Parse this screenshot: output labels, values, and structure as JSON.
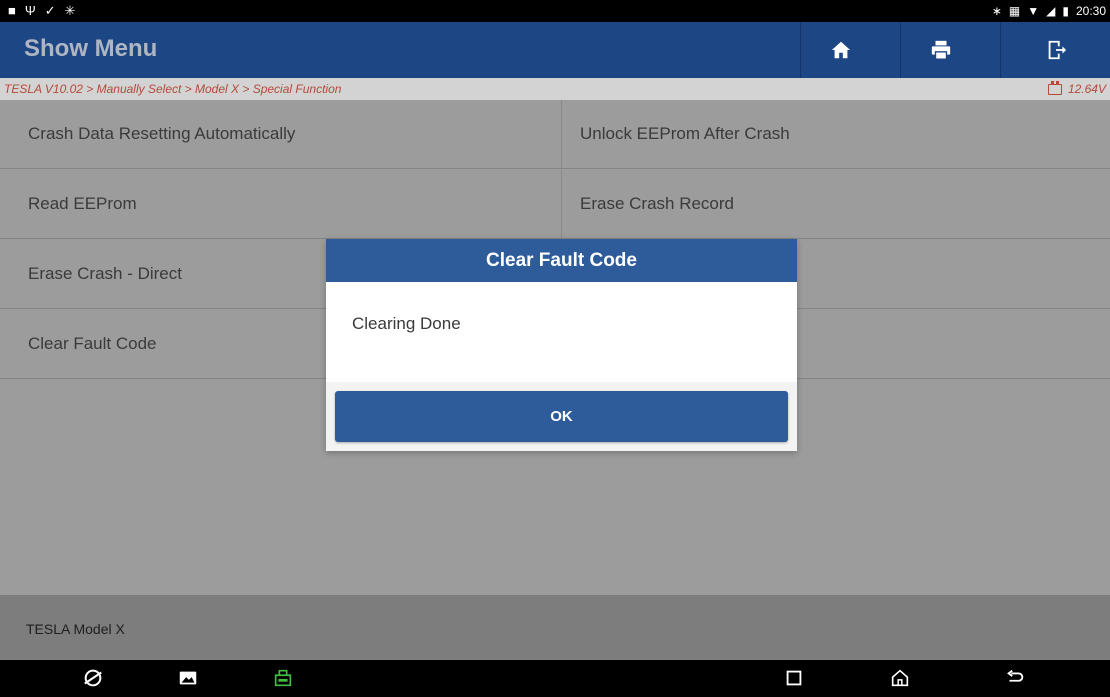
{
  "status_bar": {
    "left_icons": [
      "gallery-icon",
      "usb-debug-icon",
      "check-icon",
      "bluetooth-service-icon"
    ],
    "right_icons": [
      "bluetooth-icon",
      "vibrate-icon",
      "wifi-icon",
      "signal-icon",
      "battery-icon"
    ],
    "time": "20:30"
  },
  "header": {
    "title": "Show Menu",
    "buttons": [
      "home-icon",
      "print-icon",
      "exit-icon"
    ]
  },
  "breadcrumb": {
    "path": "TESLA V10.02 > Manually Select > Model X > Special Function",
    "voltage": "12.64V"
  },
  "menu": {
    "items": [
      "Crash Data Resetting Automatically",
      "Unlock EEProm After Crash",
      "Read EEProm",
      "Erase Crash Record",
      "Erase Crash - Direct",
      "Clear Fault Code"
    ]
  },
  "footer": {
    "vehicle": "TESLA Model X"
  },
  "dialog": {
    "title": "Clear Fault Code",
    "message": "Clearing Done",
    "ok_label": "OK"
  },
  "nav_bar": {
    "icons": [
      "browser-icon",
      "gallery-icon",
      "vci-icon",
      "recent-apps-icon",
      "home-icon",
      "back-icon"
    ]
  },
  "colors": {
    "header": "#1d4684",
    "dialog_accent": "#2e5c9b",
    "breadcrumb_text": "#b34a3a",
    "vci_green": "#3fbf3f"
  }
}
